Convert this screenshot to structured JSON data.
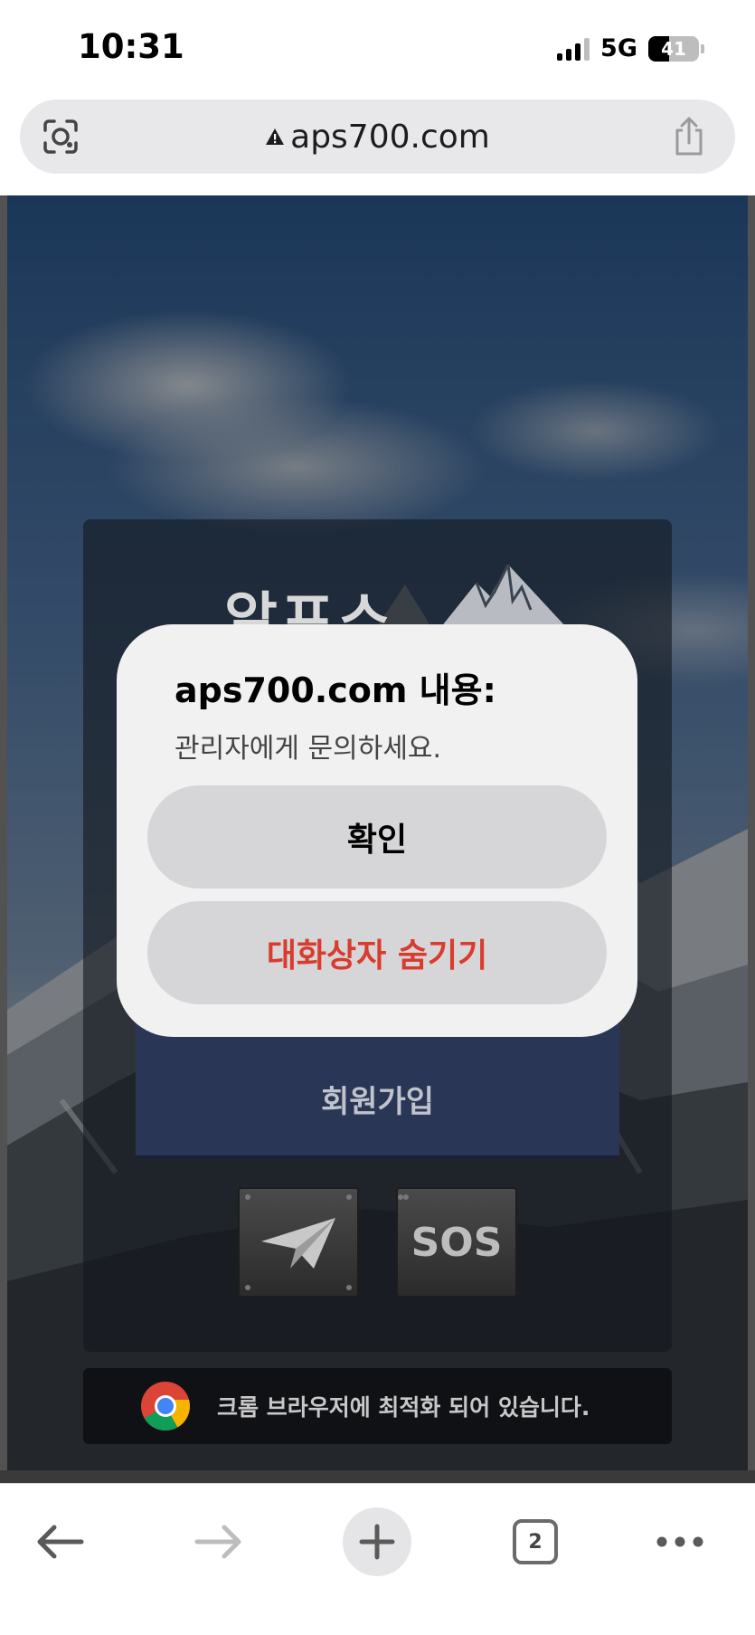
{
  "status_bar": {
    "time": "10:31",
    "network": "5G",
    "battery": "41",
    "battery_level": 0.41
  },
  "browser": {
    "url": "aps700.com",
    "icons": {
      "left": "lens-icon",
      "security": "warning-icon",
      "right": "share-icon"
    }
  },
  "page": {
    "logo_text": "알프스",
    "join_button": "회원가입",
    "telegram_icon": "telegram-icon",
    "sos_label": "SOS",
    "chrome_notice": "크롬 브라우저에 최적화 되어 있습니다."
  },
  "dialog": {
    "title": "aps700.com 내용:",
    "message": "관리자에게 문의하세요.",
    "ok_label": "확인",
    "suppress_label": "대화상자 숨기기"
  },
  "toolbar": {
    "tab_count": "2",
    "icons": [
      "back-arrow-icon",
      "forward-arrow-icon",
      "plus-icon",
      "tabs-icon",
      "more-icon"
    ]
  },
  "colors": {
    "danger": "#d93b2f",
    "dialog_bg": "#f1f1f2",
    "dialog_button": "#d6d6d8",
    "join_button": "#2a3656"
  }
}
